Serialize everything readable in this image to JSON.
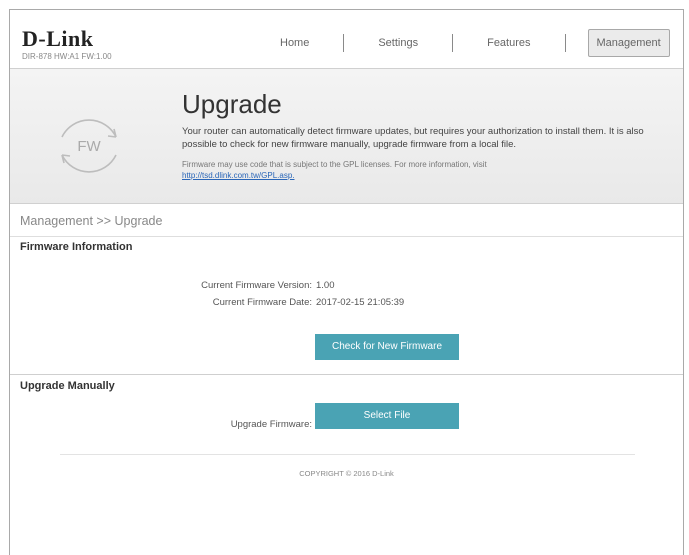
{
  "header": {
    "logo": "D-Link",
    "model": "DIR-878 HW:A1 FW:1.00"
  },
  "nav": {
    "items": [
      {
        "label": "Home"
      },
      {
        "label": "Settings"
      },
      {
        "label": "Features"
      },
      {
        "label": "Management"
      }
    ],
    "active": "Management"
  },
  "banner": {
    "icon_label": "FW",
    "title": "Upgrade",
    "description": "Your router can automatically detect firmware updates, but requires your authorization to install them. It is also possible to check for new firmware manually, upgrade firmware from a local file.",
    "note": "Firmware may use code that is subject to the GPL licenses. For more information, visit",
    "link": "http://tsd.dlink.com.tw/GPL.asp."
  },
  "breadcrumb": "Management >> Upgrade",
  "firmware_info": {
    "title": "Firmware Information",
    "version_label": "Current Firmware Version:",
    "version_value": "1.00",
    "date_label": "Current Firmware Date:",
    "date_value": "2017-02-15 21:05:39",
    "check_button": "Check for New Firmware"
  },
  "manual": {
    "title": "Upgrade Manually",
    "upgrade_label": "Upgrade Firmware:",
    "select_button": "Select File"
  },
  "footer": {
    "copyright": "COPYRIGHT © 2016 D-Link"
  },
  "colors": {
    "accent": "#4aa3b4",
    "link": "#2a66b8"
  }
}
